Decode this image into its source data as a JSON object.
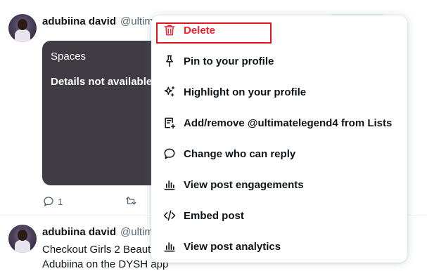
{
  "tweet1": {
    "name": "adubiina david",
    "handle": "@ultim",
    "card": {
      "title": "Spaces",
      "detail": "Details not available"
    },
    "reply_count": "1"
  },
  "tweet2": {
    "name": "adubiina david",
    "handle": "@ultim",
    "text_line1": "Checkout Girls 2 Beaut",
    "text_line2": "Adubiina  on the DYSH app"
  },
  "menu": {
    "items": [
      {
        "label": "Delete",
        "icon": "trash-icon",
        "danger": true
      },
      {
        "label": "Pin to your profile",
        "icon": "pin-icon"
      },
      {
        "label": "Highlight on your profile",
        "icon": "sparkle-icon"
      },
      {
        "label": "Add/remove @ultimatelegend4 from Lists",
        "icon": "list-add-icon"
      },
      {
        "label": "Change who can reply",
        "icon": "speech-bubble-icon"
      },
      {
        "label": "View post engagements",
        "icon": "bar-chart-icon"
      },
      {
        "label": "Embed post",
        "icon": "code-icon"
      },
      {
        "label": "View post analytics",
        "icon": "bar-chart-icon"
      }
    ]
  },
  "colors": {
    "danger": "#f4212e",
    "annotation": "#e0141c"
  }
}
